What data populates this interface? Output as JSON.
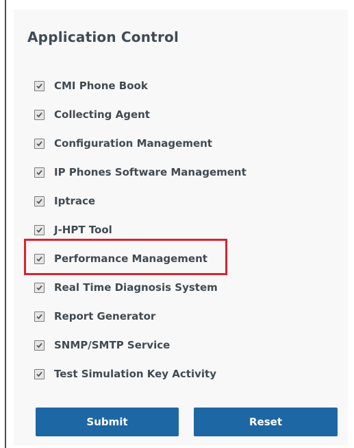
{
  "form": {
    "title": "Application Control",
    "applications": [
      {
        "label": "CMI Phone Book",
        "checked": true
      },
      {
        "label": "Collecting Agent",
        "checked": true
      },
      {
        "label": "Configuration Management",
        "checked": true
      },
      {
        "label": "IP Phones Software Management",
        "checked": true
      },
      {
        "label": "Iptrace",
        "checked": true
      },
      {
        "label": "J-HPT Tool",
        "checked": true
      },
      {
        "label": "Performance Management",
        "checked": true,
        "highlighted": true
      },
      {
        "label": "Real Time Diagnosis System",
        "checked": true
      },
      {
        "label": "Report Generator",
        "checked": true
      },
      {
        "label": "SNMP/SMTP Service",
        "checked": true
      },
      {
        "label": "Test Simulation Key Activity",
        "checked": true
      }
    ],
    "submit_label": "Submit",
    "reset_label": "Reset"
  },
  "colors": {
    "button": "#1d67a4",
    "highlight": "#d9232d",
    "title": "#3f4b57"
  },
  "icons": {
    "checkbox": "checked-checkbox-icon"
  }
}
